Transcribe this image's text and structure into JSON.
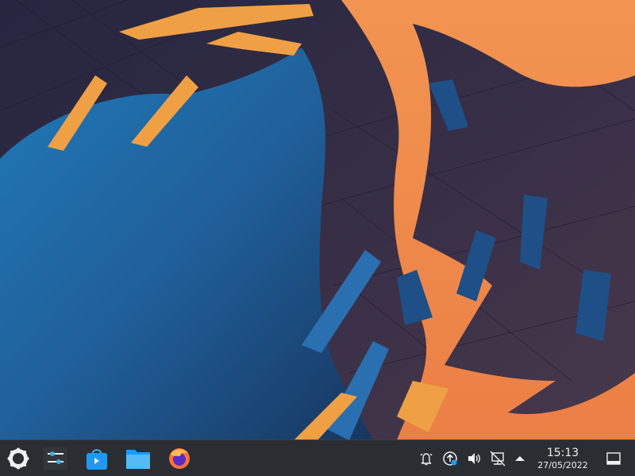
{
  "panel": {
    "launcher": {
      "icon": "plasma-kickoff-icon"
    },
    "task_manager": {
      "apps": [
        {
          "icon": "system-settings-icon"
        },
        {
          "icon": "discover-store-icon"
        },
        {
          "icon": "dolphin-folder-icon"
        },
        {
          "icon": "firefox-icon"
        }
      ]
    },
    "system_tray": {
      "icons": [
        "notifications-bell-icon",
        "update-notifier-icon",
        "volume-icon",
        "network-icon",
        "tray-expand-arrow-icon"
      ]
    },
    "clock": {
      "time": "15:13",
      "date": "27/05/2022"
    },
    "show_desktop": {
      "icon": "show-desktop-icon"
    }
  },
  "colors": {
    "panel_bg": "#2a2e33",
    "panel_text": "#eff0f1",
    "wall_orange": "#f08c4c",
    "wall_blue": "#1d5f9c",
    "wall_dark": "#262540"
  }
}
